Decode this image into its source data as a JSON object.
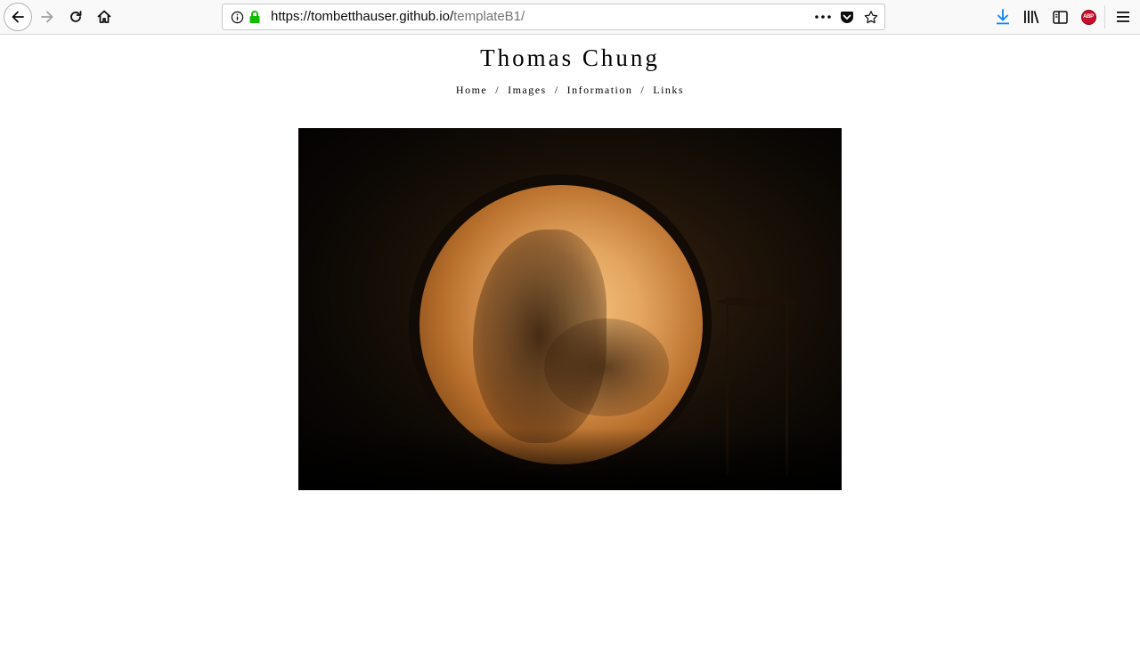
{
  "browser": {
    "url_host": "https://tombetthauser.github.io/",
    "url_path": "templateB1/",
    "icons": {
      "back": "arrow-left-icon",
      "forward": "arrow-right-icon",
      "reload": "reload-icon",
      "home": "home-icon",
      "site_info": "info-icon",
      "lock": "lock-icon",
      "page_actions": "more-dots-icon",
      "pocket": "pocket-icon",
      "bookmark": "star-icon",
      "downloads": "download-arrow-icon",
      "library": "library-icon",
      "sidebar": "sidebar-icon",
      "adblock": "abp-icon",
      "menu": "hamburger-icon"
    },
    "adblock_label": "ABP",
    "colors": {
      "lock": "#12bc00",
      "download": "#0a84ff",
      "abp": "#c70d2c"
    }
  },
  "site": {
    "title": "Thomas Chung",
    "nav": [
      {
        "label": "Home"
      },
      {
        "label": "Images"
      },
      {
        "label": "Information"
      },
      {
        "label": "Links"
      }
    ],
    "nav_separator": "/"
  }
}
